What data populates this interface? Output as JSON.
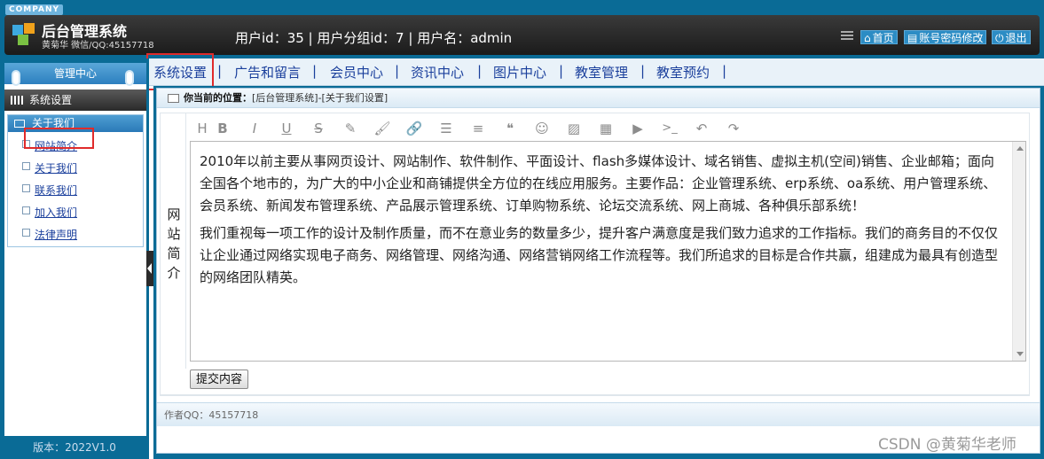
{
  "header": {
    "company_badge": "COMPANY",
    "app_title": "后台管理系统",
    "app_subtitle": "黄菊华 微信/QQ:45157718",
    "user_info": "用户id：35 | 用户分组id：7 | 用户名：admin",
    "buttons": [
      {
        "icon": "home-icon",
        "glyph": "⌂",
        "label": "首页"
      },
      {
        "icon": "list-icon",
        "glyph": "▤",
        "label": "账号密码修改"
      },
      {
        "icon": "power-icon",
        "glyph": "⏻",
        "label": "退出"
      }
    ]
  },
  "nav": {
    "items": [
      "系统设置",
      "广告和留言",
      "会员中心",
      "资讯中心",
      "图片中心",
      "教室管理",
      "教室预约"
    ],
    "separator": "|",
    "active_index": 0
  },
  "sidebar": {
    "title": "管理中心",
    "section": "系统设置",
    "group_title": "关于我们",
    "links": [
      "网站简介",
      "关于我们",
      "联系我们",
      "加入我们",
      "法律声明"
    ],
    "highlighted_index": 0,
    "version": "版本：2022V1.0"
  },
  "location": {
    "prefix": "你当前的位置：",
    "path": "[后台管理系统]-[关于我们设置]"
  },
  "form": {
    "field_label": "网站简介",
    "toolbar_icons": [
      {
        "name": "heading-icon",
        "glyph": "H"
      },
      {
        "name": "bold-icon",
        "glyph": "B"
      },
      {
        "name": "italic-icon",
        "glyph": "I"
      },
      {
        "name": "underline-icon",
        "glyph": "U"
      },
      {
        "name": "strikethrough-icon",
        "glyph": "S"
      },
      {
        "name": "eraser-icon",
        "glyph": "✎"
      },
      {
        "name": "brush-icon",
        "glyph": "🖌"
      },
      {
        "name": "link-icon",
        "glyph": "🔗"
      },
      {
        "name": "bullet-list-icon",
        "glyph": "☰"
      },
      {
        "name": "align-icon",
        "glyph": "≡"
      },
      {
        "name": "quote-icon",
        "glyph": "❝"
      },
      {
        "name": "emoji-icon",
        "glyph": "☺"
      },
      {
        "name": "image-icon",
        "glyph": "▨"
      },
      {
        "name": "table-icon",
        "glyph": "▦"
      },
      {
        "name": "video-icon",
        "glyph": "▶"
      },
      {
        "name": "code-icon",
        "glyph": ">_"
      },
      {
        "name": "undo-icon",
        "glyph": "↶"
      },
      {
        "name": "redo-icon",
        "glyph": "↷"
      }
    ],
    "paragraphs": [
      "2010年以前主要从事网页设计、网站制作、软件制作、平面设计、flash多媒体设计、域名销售、虚拟主机(空间)销售、企业邮箱；面向全国各个地市的，为广大的中小企业和商铺提供全方位的在线应用服务。主要作品：企业管理系统、erp系统、oa系统、用户管理系统、会员系统、新闻发布管理系统、产品展示管理系统、订单购物系统、论坛交流系统、网上商城、各种俱乐部系统！",
      "我们重视每一项工作的设计及制作质量，而不在意业务的数量多少，提升客户满意度是我们致力追求的工作指标。我们的商务目的不仅仅让企业通过网络实现电子商务、网络管理、网络沟通、网络营销网络工作流程等。我们所追求的目标是合作共赢，组建成为最具有创造型的网络团队精英。"
    ],
    "submit_label": "提交内容"
  },
  "footer": {
    "author": "作者QQ：45157718"
  },
  "watermark": "CSDN @黄菊华老师",
  "colors": {
    "frame_blue": "#0a6b96",
    "link_blue": "#1a3f9c",
    "highlight_red": "#e02b2b"
  }
}
